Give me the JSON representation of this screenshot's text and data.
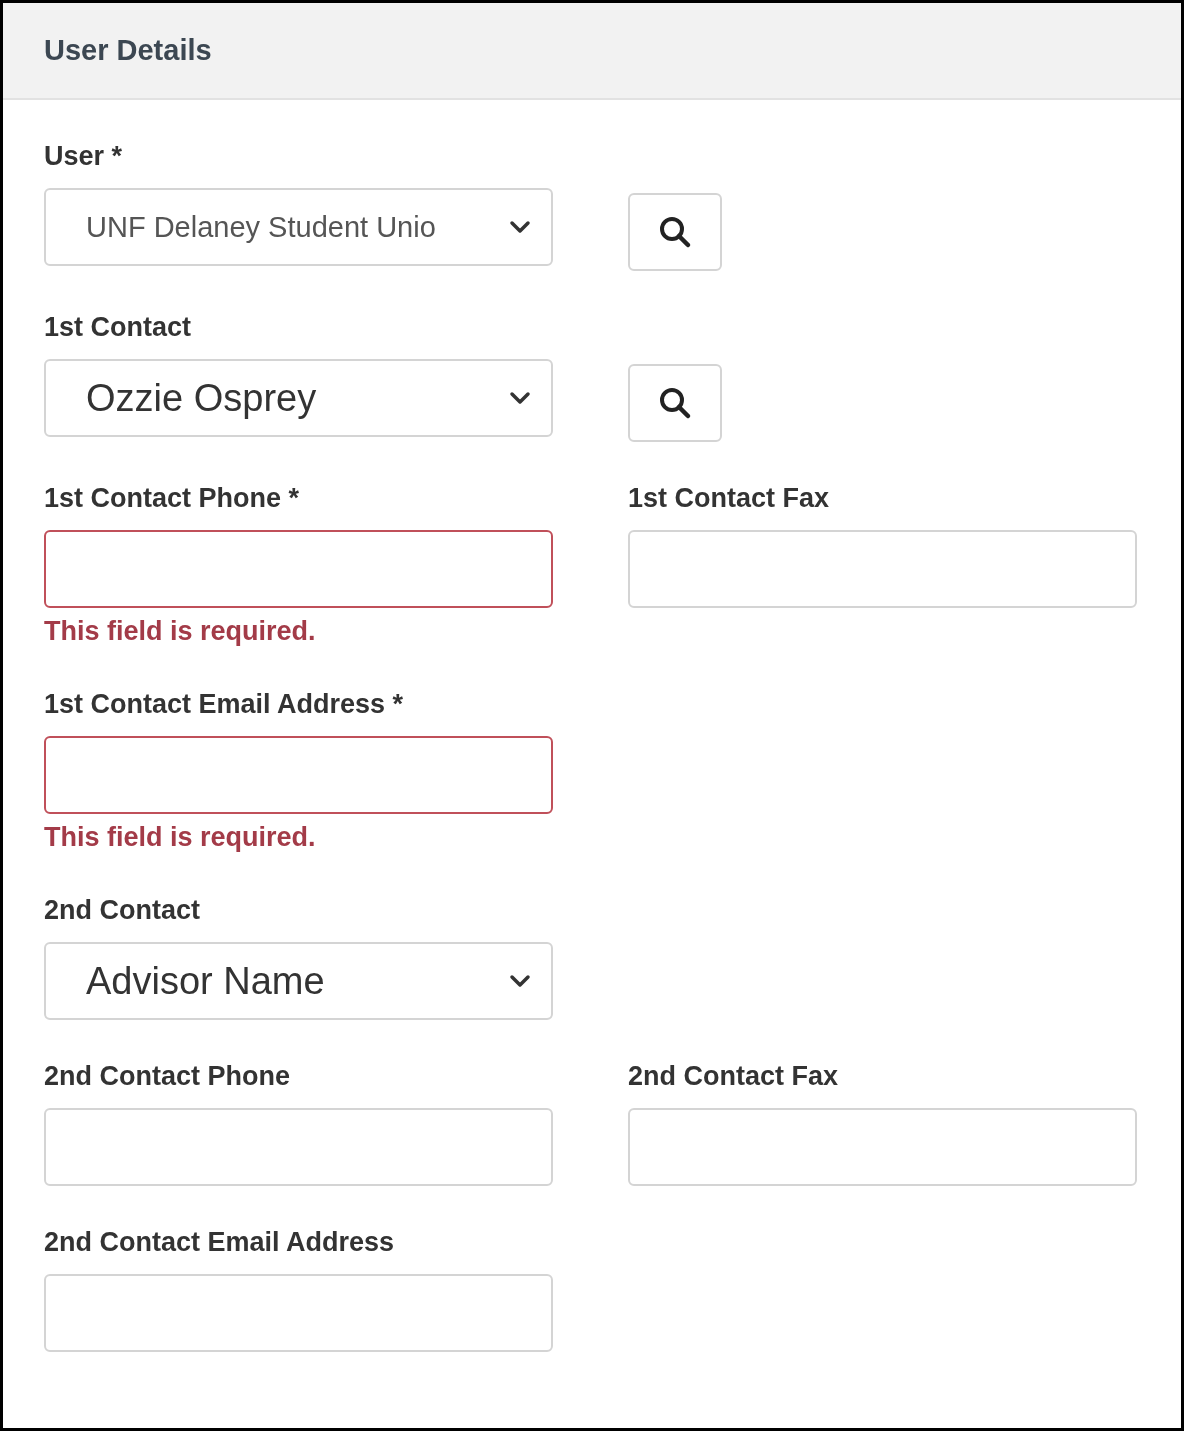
{
  "panel": {
    "title": "User Details"
  },
  "rows": [
    {
      "fields": [
        {
          "kind": "select",
          "label": "User *",
          "value": "UNF Delaney Student Unio",
          "search": true
        }
      ]
    },
    {
      "fields": [
        {
          "kind": "select",
          "label": "1st Contact",
          "value": "Ozzie Osprey",
          "search": true
        }
      ]
    },
    {
      "fields": [
        {
          "kind": "input",
          "label": "1st Contact Phone *",
          "invalid": true,
          "error": "This field is required."
        },
        {
          "kind": "input",
          "label": "1st Contact Fax",
          "invalid": false
        }
      ]
    },
    {
      "fields": [
        {
          "kind": "input",
          "label": "1st Contact Email Address *",
          "invalid": true,
          "error": "This field is required."
        }
      ]
    },
    {
      "fields": [
        {
          "kind": "select",
          "label": "2nd Contact",
          "value": "Advisor Name",
          "search": false
        }
      ]
    },
    {
      "fields": [
        {
          "kind": "input",
          "label": "2nd Contact Phone",
          "invalid": false
        },
        {
          "kind": "input",
          "label": "2nd Contact Fax",
          "invalid": false
        }
      ]
    },
    {
      "fields": [
        {
          "kind": "input",
          "label": "2nd Contact Email Address",
          "invalid": false
        }
      ]
    }
  ]
}
